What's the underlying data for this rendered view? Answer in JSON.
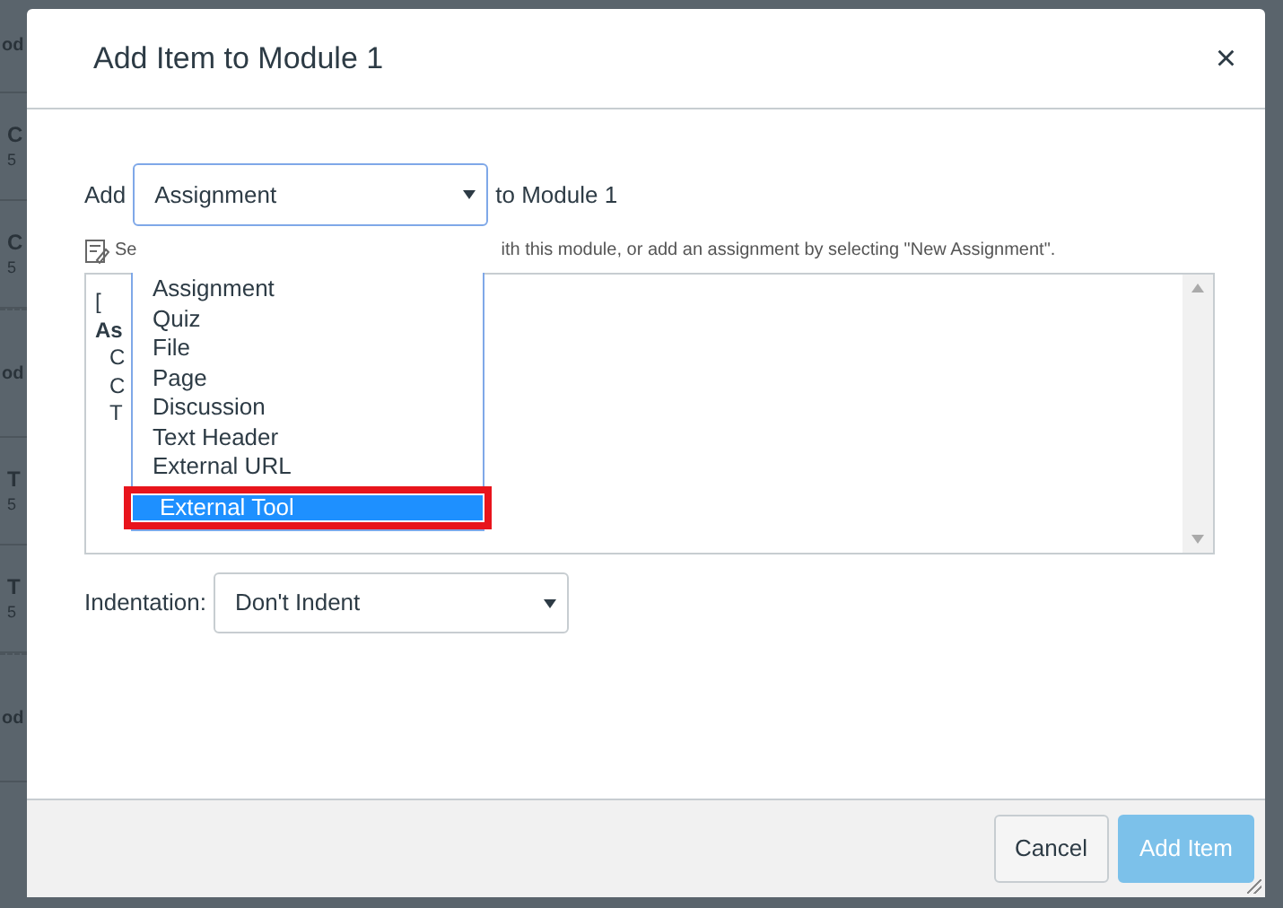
{
  "background_page": {
    "rows": [
      {
        "kind": "heading",
        "title": "od"
      },
      {
        "kind": "item",
        "title": "C",
        "subtitle": "5"
      },
      {
        "kind": "item",
        "title": "C",
        "subtitle": "5"
      },
      {
        "kind": "heading",
        "title": "od"
      },
      {
        "kind": "item",
        "title": "T",
        "subtitle": "5"
      },
      {
        "kind": "item",
        "title": "T",
        "subtitle": "5"
      },
      {
        "kind": "heading",
        "title": "od"
      }
    ]
  },
  "modal": {
    "title": "Add Item to Module 1",
    "close": "×",
    "add_label": "Add",
    "type_select": {
      "value": "Assignment",
      "open": true
    },
    "options": [
      {
        "label": "Assignment",
        "selected": false,
        "outlined": false
      },
      {
        "label": "Quiz",
        "selected": false,
        "outlined": false
      },
      {
        "label": "File",
        "selected": false,
        "outlined": false
      },
      {
        "label": "Page",
        "selected": false,
        "outlined": false
      },
      {
        "label": "Discussion",
        "selected": false,
        "outlined": false
      },
      {
        "label": "Text Header",
        "selected": false,
        "outlined": false
      },
      {
        "label": "External URL",
        "selected": false,
        "outlined": false
      },
      {
        "label": "External Tool",
        "selected": true,
        "outlined": true
      }
    ],
    "suffix": "to Module 1",
    "hint": {
      "before": "Se",
      "after": "ith this module, or add an assignment by selecting \"New Assignment\"."
    },
    "listing": [
      {
        "text": "[",
        "bold": false,
        "indented": false
      },
      {
        "text": "As",
        "bold": true,
        "indented": false
      },
      {
        "text": "C",
        "bold": false,
        "indented": true
      },
      {
        "text": "C",
        "bold": false,
        "indented": true
      },
      {
        "text": "T",
        "bold": false,
        "indented": true
      }
    ],
    "indentation": {
      "label": "Indentation:",
      "value": "Don't Indent"
    },
    "buttons": [
      {
        "label": "Cancel",
        "kind": "secondary",
        "disabled": false
      },
      {
        "label": "Add Item",
        "kind": "primary",
        "disabled": true
      }
    ]
  }
}
